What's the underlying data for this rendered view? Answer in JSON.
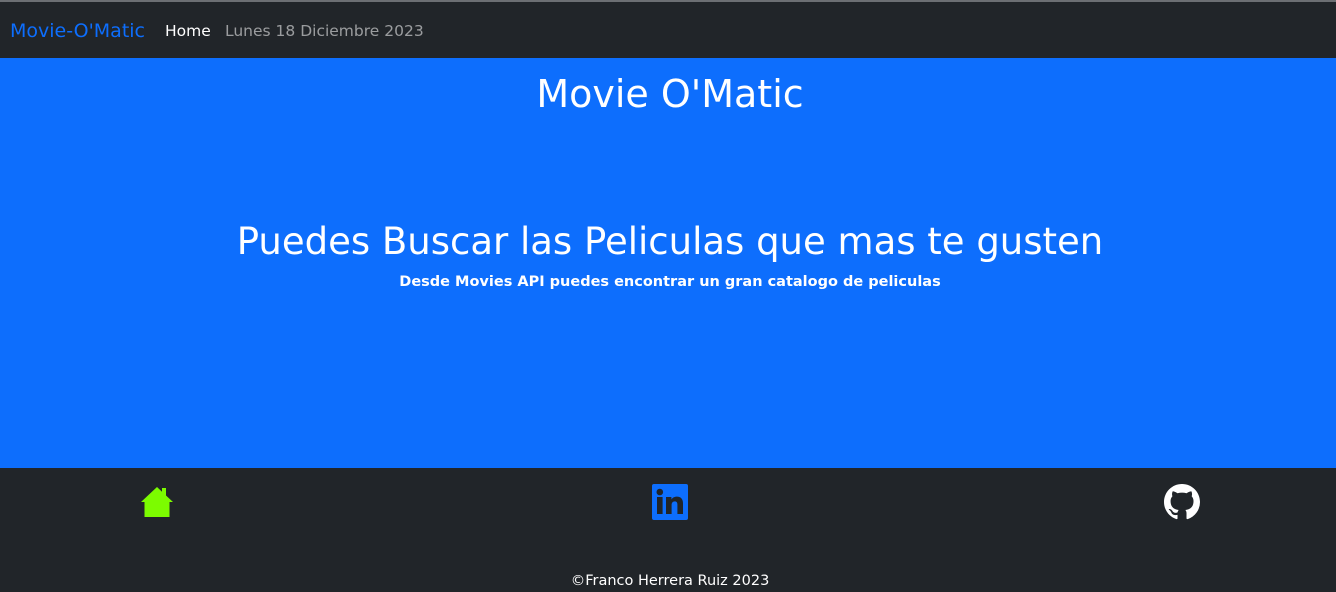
{
  "navbar": {
    "brand": "Movie-O'Matic",
    "home_label": "Home",
    "date_text": "Lunes 18 Diciembre 2023"
  },
  "hero": {
    "title": "Movie O'Matic",
    "heading": "Puedes Buscar las Peliculas que mas te gusten",
    "subtitle": "Desde Movies API puedes encontrar un gran catalogo de peliculas"
  },
  "footer": {
    "icons": [
      "home-icon",
      "linkedin-icon",
      "github-icon"
    ],
    "copyright": "©Franco Herrera Ruiz 2023"
  },
  "colors": {
    "navbar_bg": "#212529",
    "brand": "#0d6efd",
    "hero_bg": "#0d6efd",
    "home_icon": "#7cfc00",
    "linkedin_icon": "#0d6efd",
    "github_icon": "#ffffff"
  }
}
